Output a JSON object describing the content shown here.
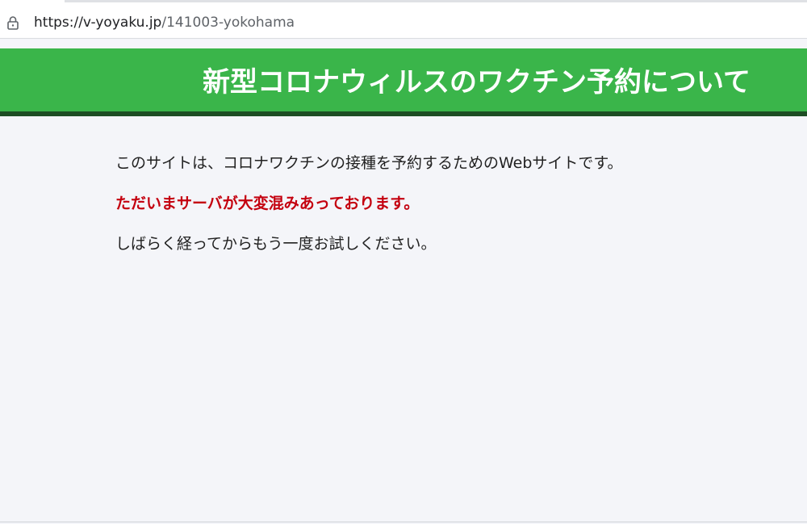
{
  "browser": {
    "url_host": "https://v-yoyaku.jp",
    "url_path": "/141003-yokohama",
    "icons": {
      "site_info": "lock-icon"
    }
  },
  "header": {
    "title": "新型コロナウィルスのワクチン予約について"
  },
  "content": {
    "intro": "このサイトは、コロナワクチンの接種を予約するためのWebサイトです。",
    "alert": "ただいまサーバが大変混みあっております。",
    "retry": "しばらく経ってからもう一度お試しください。"
  },
  "colors": {
    "banner": "#3ab54a",
    "banner_border": "#1d4d24",
    "alert_text": "#c4000f",
    "page_background": "#f4f5f9"
  }
}
